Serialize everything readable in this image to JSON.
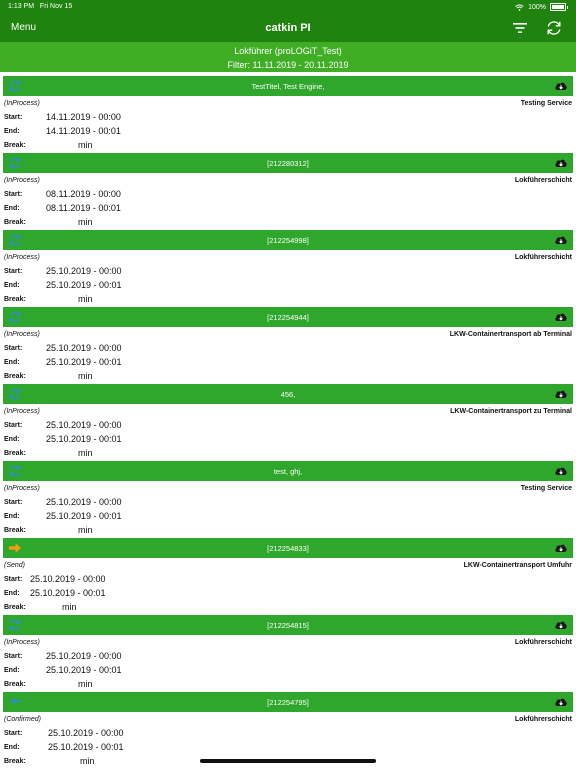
{
  "status_bar": {
    "time": "1:13 PM",
    "date": "Fri Nov 15",
    "battery": "100%"
  },
  "navbar": {
    "menu_label": "Menu",
    "title": "catkin PI",
    "filter_icon": "filter-icon",
    "refresh_icon": "refresh-icon"
  },
  "subheader": {
    "line1": "Lokführer (proLOGiT_Test)",
    "line2": "Filter: 11.11.2019 - 20.11.2019"
  },
  "labels": {
    "start": "Start:",
    "end": "End:",
    "break": "Break:"
  },
  "colors": {
    "bar": "#21830f",
    "subheader": "#3fae24",
    "entry_header": "#2fa72c",
    "send_arrow": "#f39c12",
    "sync_icon": "#2d8fd5"
  },
  "entries": [
    {
      "title": "TestTitel, Test Engine,",
      "icon": "sync-icon",
      "status": "(InProcess)",
      "service": "Testing Service",
      "start": "14.11.2019 - 00:00",
      "end": "14.11.2019 - 00:01",
      "break": "min"
    },
    {
      "title": "[212280312]",
      "icon": "sync-icon",
      "status": "(InProcess)",
      "service": "Lokführerschicht",
      "start": "08.11.2019 - 00:00",
      "end": "08.11.2019 - 00:01",
      "break": "min"
    },
    {
      "title": "[212254998]",
      "icon": "sync-icon",
      "status": "(InProcess)",
      "service": "Lokführerschicht",
      "start": "25.10.2019 - 00:00",
      "end": "25.10.2019 - 00:01",
      "break": "min"
    },
    {
      "title": "[212254944]",
      "icon": "sync-icon",
      "status": "(InProcess)",
      "service": "LKW-Containertransport ab Terminal",
      "start": "25.10.2019 - 00:00",
      "end": "25.10.2019 - 00:01",
      "break": "min"
    },
    {
      "title": "456,",
      "icon": "sync-icon",
      "status": "(InProcess)",
      "service": "LKW-Containertransport zu Terminal",
      "start": "25.10.2019 - 00:00",
      "end": "25.10.2019 - 00:01",
      "break": "min"
    },
    {
      "title": "test, ghj,",
      "icon": "sync-icon",
      "status": "(InProcess)",
      "service": "Testing Service",
      "start": "25.10.2019 - 00:00",
      "end": "25.10.2019 - 00:01",
      "break": "min"
    },
    {
      "title": "[212254833]",
      "icon": "arrow-right-icon",
      "status": "(Send)",
      "service": "LKW-Containertransport Umfuhr",
      "start": "25.10.2019 - 00:00",
      "end": "25.10.2019 - 00:01",
      "break": "min"
    },
    {
      "title": "[212254815]",
      "icon": "sync-icon",
      "status": "(InProcess)",
      "service": "Lokführerschicht",
      "start": "25.10.2019 - 00:00",
      "end": "25.10.2019 - 00:01",
      "break": "min"
    },
    {
      "title": "[212254795]",
      "icon": "arrow-left-icon",
      "status": "(Confirmed)",
      "service": "Lokführerschicht",
      "start": "25.10.2019 - 00:00",
      "end": "25.10.2019 - 00:01",
      "break": "min"
    }
  ]
}
